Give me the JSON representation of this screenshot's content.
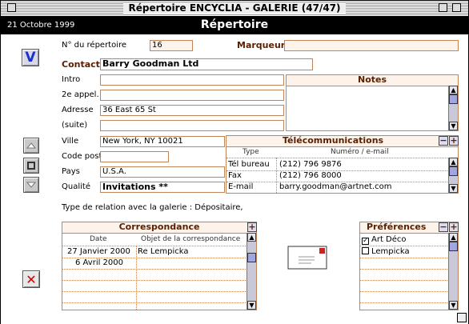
{
  "window": {
    "title": "Répertoire ENCYCLIA - GALERIE (47/47)"
  },
  "header": {
    "date": "21 Octobre 1999",
    "title": "Répertoire"
  },
  "form": {
    "repertoire_label": "N° du répertoire",
    "repertoire_value": "16",
    "marqueur_label": "Marqueur",
    "marqueur_value": "",
    "contact_label": "Contact",
    "contact_value": "Barry Goodman Ltd",
    "intro_label": "Intro",
    "intro_value": "",
    "appel_label": "2e appel.",
    "appel_value": "",
    "adresse_label": "Adresse",
    "adresse_value": "36 East 65 St",
    "suite_label": "(suite)",
    "suite_value": "",
    "ville_label": "Ville",
    "ville_value": "New York, NY 10021",
    "codepost_label": "Code post.",
    "codepost_value": "",
    "pays_label": "Pays",
    "pays_value": "U.S.A.",
    "qualite_label": "Qualité",
    "qualite_value": "Invitations **",
    "relation_text": "Type de relation avec la galerie : Dépositaire,"
  },
  "notes": {
    "title": "Notes",
    "content": ""
  },
  "telecom": {
    "title": "Télécommunications",
    "col_type": "Type",
    "col_numero": "Numéro / e-mail",
    "rows": [
      {
        "type": "Tél bureau",
        "value": "(212) 796 9876"
      },
      {
        "type": "Fax",
        "value": "(212) 796 8000"
      },
      {
        "type": "E-mail",
        "value": "barry.goodman@artnet.com"
      }
    ]
  },
  "correspondance": {
    "title": "Correspondance",
    "col_date": "Date",
    "col_objet": "Objet de la correspondance",
    "rows": [
      {
        "date": "27 Janvier 2000",
        "objet": "Re Lempicka"
      },
      {
        "date": "6 Avril 2000",
        "objet": ""
      }
    ]
  },
  "preferences": {
    "title": "Préférences",
    "items": [
      {
        "label": "Art Déco",
        "checked": true
      },
      {
        "label": "Lempicka",
        "checked": false
      }
    ]
  },
  "icons": {
    "nav_button": "V",
    "plus": "+",
    "minus": "−",
    "delete": "✕",
    "up": "▲",
    "down": "▼"
  },
  "colors": {
    "accent_border": "#c2855a",
    "label_brown": "#5a1f00",
    "delete_red": "#d00000",
    "nav_blue": "#1a2fd0"
  }
}
